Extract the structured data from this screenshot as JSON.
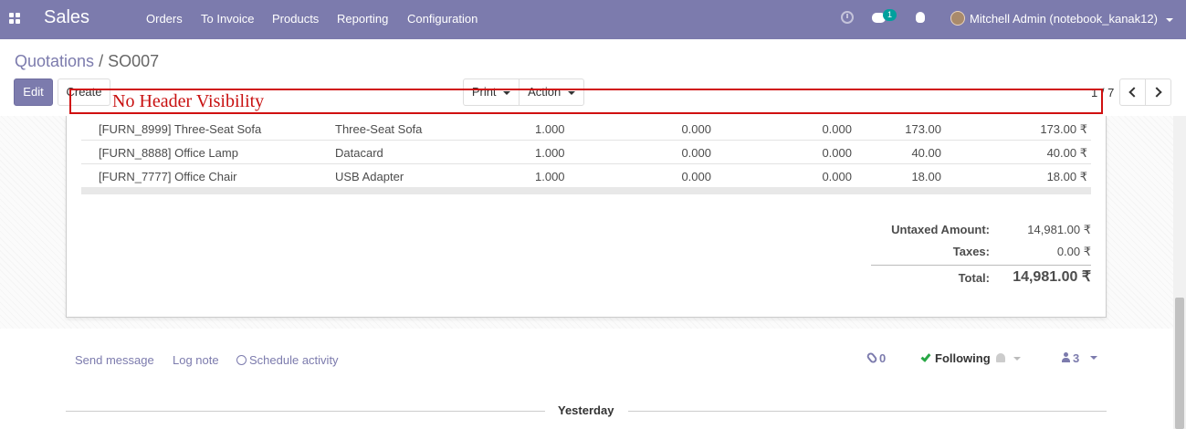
{
  "navbar": {
    "app_name": "Sales",
    "menu": [
      "Orders",
      "To Invoice",
      "Products",
      "Reporting",
      "Configuration"
    ],
    "chat_badge": "1",
    "user_name": "Mitchell Admin (notebook_kanak12)"
  },
  "breadcrumb": {
    "parent": "Quotations",
    "separator": "/",
    "current": "SO007"
  },
  "buttons": {
    "edit": "Edit",
    "create": "Create",
    "print": "Print",
    "action": "Action"
  },
  "pager": "1 / 7",
  "annotation": "No Header Visibility",
  "order_lines": [
    {
      "product": "[FURN_8999] Three-Seat Sofa",
      "description": "Three-Seat Sofa",
      "quantity": "1.000",
      "col_a": "0.000",
      "col_b": "0.000",
      "unit_price": "173.00",
      "subtotal": "173.00 ₹"
    },
    {
      "product": "[FURN_8888] Office Lamp",
      "description": "Datacard",
      "quantity": "1.000",
      "col_a": "0.000",
      "col_b": "0.000",
      "unit_price": "40.00",
      "subtotal": "40.00 ₹"
    },
    {
      "product": "[FURN_7777] Office Chair",
      "description": "USB Adapter",
      "quantity": "1.000",
      "col_a": "0.000",
      "col_b": "0.000",
      "unit_price": "18.00",
      "subtotal": "18.00 ₹"
    }
  ],
  "totals": {
    "untaxed_label": "Untaxed Amount:",
    "untaxed_value": "14,981.00 ₹",
    "taxes_label": "Taxes:",
    "taxes_value": "0.00 ₹",
    "total_label": "Total:",
    "total_value": "14,981.00 ₹"
  },
  "chatter": {
    "send_message": "Send message",
    "log_note": "Log note",
    "schedule_activity": "Schedule activity",
    "attachments": "0",
    "following": "Following",
    "followers": "3",
    "date_separator": "Yesterday"
  },
  "colors": {
    "brand": "#7c7bad",
    "annotation": "#d01010",
    "badge": "#00a09d",
    "success": "#28a745"
  }
}
